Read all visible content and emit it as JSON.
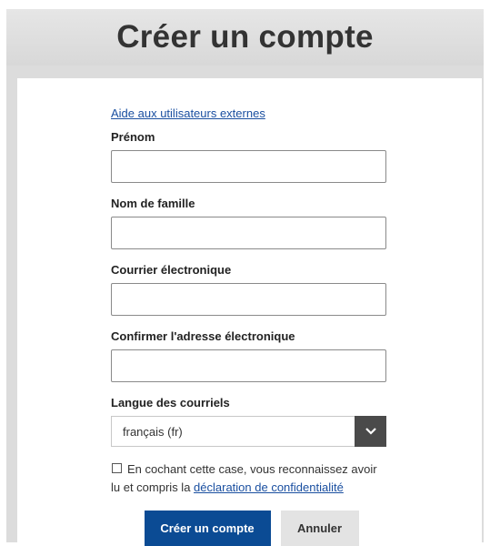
{
  "page": {
    "title": "Créer un compte"
  },
  "form": {
    "help_link": "Aide aux utilisateurs externes",
    "first_name": {
      "label": "Prénom",
      "value": ""
    },
    "last_name": {
      "label": "Nom de famille",
      "value": ""
    },
    "email": {
      "label": "Courrier électronique",
      "value": ""
    },
    "email_confirm": {
      "label": "Confirmer l'adresse électronique",
      "value": ""
    },
    "language": {
      "label": "Langue des courriels",
      "selected": "français (fr)"
    },
    "consent": {
      "checked": false,
      "text": "En cochant cette case, vous reconnaissez avoir lu et compris la ",
      "link": "déclaration de confidentialité"
    },
    "buttons": {
      "submit": "Créer un compte",
      "cancel": "Annuler"
    }
  },
  "colors": {
    "primary": "#0b4b94",
    "link": "#1a4fa0",
    "header_bg": "#dcdcdc"
  }
}
